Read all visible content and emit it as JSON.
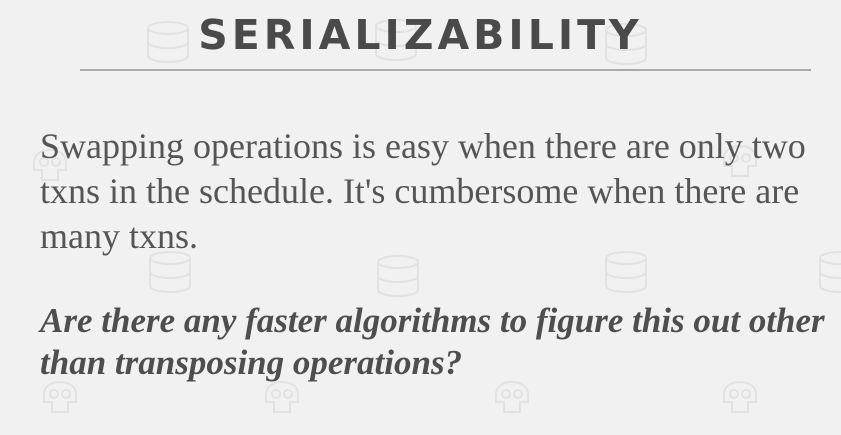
{
  "slide": {
    "title": "SERIALIZABILITY",
    "body": "Swapping operations is easy when there are only two txns in the schedule. It's cumbersome when there are many txns.",
    "question": "Are there any faster algorithms to figure this out other than transposing operations?"
  },
  "background": {
    "pattern_icons": [
      "database-icon",
      "skull-icon"
    ],
    "pattern_color": "#e4e4e4"
  },
  "colors": {
    "background": "#f1f1f1",
    "title": "#4a4a4a",
    "rule": "#a9a9a9",
    "text": "#555555"
  }
}
